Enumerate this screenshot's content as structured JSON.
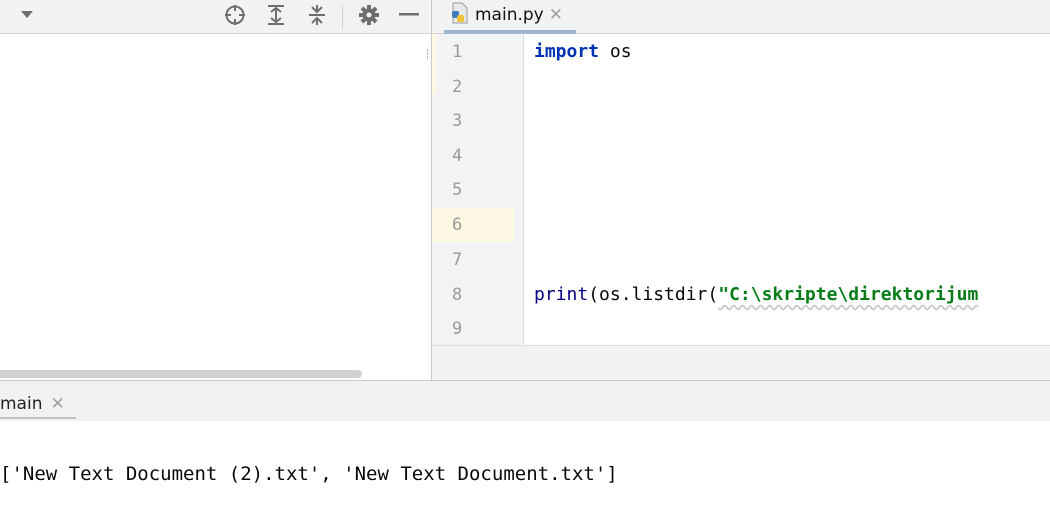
{
  "project_toolbar": {
    "icons": [
      "dropdown-arrow-icon",
      "locate-icon",
      "expand-all-icon",
      "collapse-all-icon",
      "gear-icon",
      "hide-icon"
    ]
  },
  "editor": {
    "tab": {
      "label": "main.py",
      "icon": "python-file-icon"
    },
    "line_numbers": [
      "1",
      "2",
      "3",
      "4",
      "5",
      "6",
      "7",
      "8",
      "9"
    ],
    "code": {
      "line1_keyword": "import",
      "line1_rest": " os",
      "line8_func": "print",
      "line8_mid": "(os.listdir(",
      "line8_string": "\"C:\\skripte\\direktorijum"
    }
  },
  "run_window": {
    "tab_label": "main",
    "output": "['New Text Document (2).txt', 'New Text Document.txt']"
  },
  "colors": {
    "keyword": "#0033b3",
    "string": "#067d17",
    "current_line": "#fdf8e4",
    "panel_bg": "#f2f2f2"
  }
}
